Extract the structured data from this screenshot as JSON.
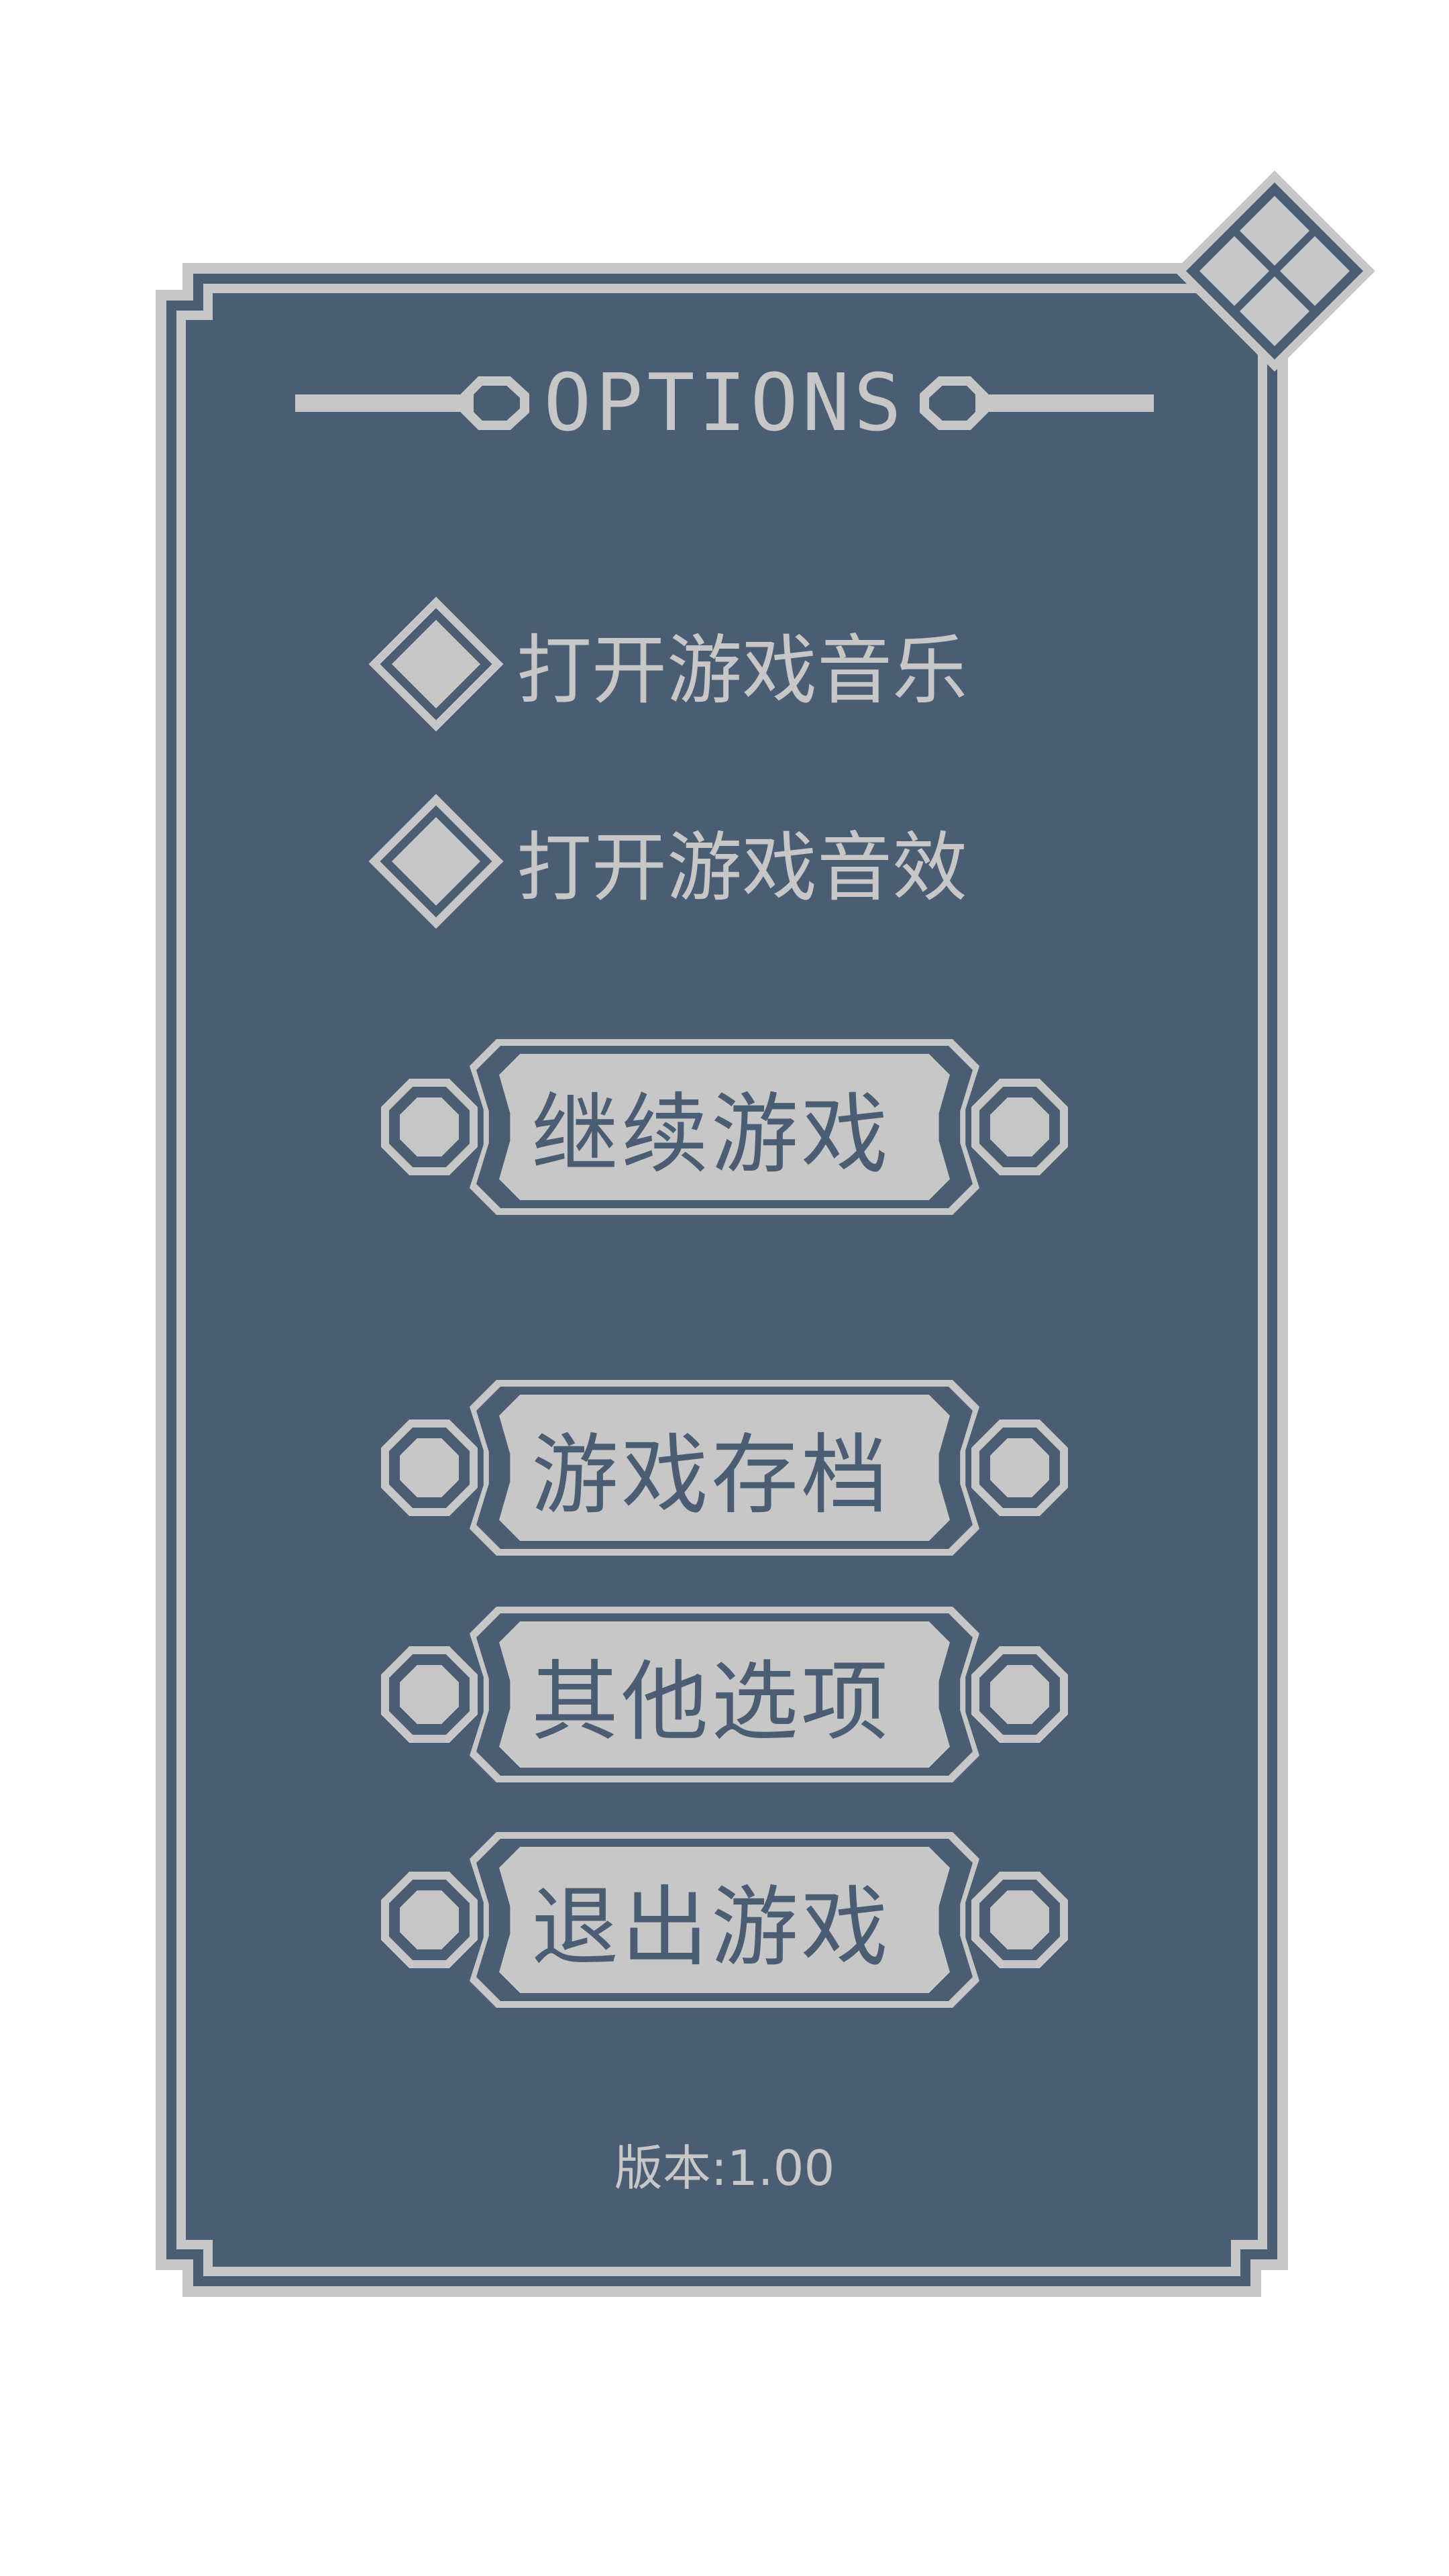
{
  "colors": {
    "panel": "#4a5d72",
    "frame": "#c7c7c7",
    "background": "#ffffff"
  },
  "header": {
    "title": "OPTIONS",
    "close_icon": "diamond-close-icon"
  },
  "toggles": [
    {
      "label": "打开游戏音乐",
      "icon": "diamond-checkbox-icon"
    },
    {
      "label": "打开游戏音效",
      "icon": "diamond-checkbox-icon"
    }
  ],
  "menu": {
    "buttons": [
      {
        "label": "继续游戏"
      },
      {
        "label": "游戏存档"
      },
      {
        "label": "其他选项"
      },
      {
        "label": "退出游戏"
      }
    ],
    "side_icon": "octagon-ornament-icon"
  },
  "footer": {
    "version": "版本:1.00"
  }
}
